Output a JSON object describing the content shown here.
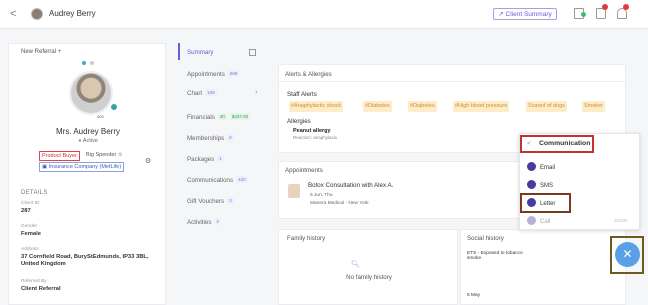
{
  "header": {
    "back_glyph": "<",
    "patient_name": "Audrey Berry",
    "client_summary_label": "Client Summary"
  },
  "profile": {
    "new_referral_label": "New Referral +",
    "photo_id": "000",
    "name": "Mrs. Audrey Berry",
    "status": "Active",
    "tags": [
      "Product Buyer",
      "Big Spender"
    ],
    "insurance": "Insurance Company (MetLife)"
  },
  "details": {
    "heading": "DETAILS",
    "fields": [
      {
        "label": "Client ID",
        "value": "287"
      },
      {
        "label": "Gender",
        "value": "Female"
      },
      {
        "label": "Address",
        "value": "37 Cornfield Road, BuryStEdmunds, IP33 3BL, United Kingdom"
      },
      {
        "label": "Referred By",
        "value": "Client Referral"
      }
    ]
  },
  "tabs": [
    {
      "label": "Summary",
      "count": ""
    },
    {
      "label": "Appointments",
      "count": "569"
    },
    {
      "label": "Chart",
      "count": "109"
    },
    {
      "label": "Financials",
      "count": "40",
      "extra": "$437.00"
    },
    {
      "label": "Memberships",
      "count": "0"
    },
    {
      "label": "Packages",
      "count": "1"
    },
    {
      "label": "Communications",
      "count": "420"
    },
    {
      "label": "Gift Vouchers",
      "count": "3"
    },
    {
      "label": "Activities",
      "count": "2"
    }
  ],
  "alerts": {
    "title": "Alerts & Allergies",
    "staff_heading": "Staff Alerts",
    "staff_alerts": [
      "#Anaphylactic shock",
      "#Diabetes",
      "#Diabetes",
      "#High blood pressure",
      "Scared of dogs",
      "Smoker"
    ],
    "allergies_heading": "Allergies",
    "allergy_name": "Peanut allergy",
    "allergy_reaction": "Reaction: anaphylaxis"
  },
  "appointments": {
    "title": "Appointments",
    "item_title": "Botox Consultation with Alex A.",
    "item_date": "6 Jun, Thu",
    "item_location": "Manera Medical - New York"
  },
  "family_history": {
    "title": "Family history",
    "empty_text": "No family history"
  },
  "social_history": {
    "title": "Social history",
    "entry": "ETS - Exposed to tobacco smoke",
    "date": "5 May"
  },
  "communication_menu": {
    "title": "Communication",
    "items": [
      {
        "label": "Email",
        "icon": "email-icon"
      },
      {
        "label": "SMS",
        "icon": "sms-icon"
      },
      {
        "label": "Letter",
        "icon": "letter-icon"
      },
      {
        "label": "Call",
        "icon": "call-icon",
        "badge": "SOON"
      }
    ]
  },
  "colors": {
    "accent": "#6a5bd6",
    "alert_bg": "#fdecc9",
    "fab": "#5aa0e6"
  }
}
